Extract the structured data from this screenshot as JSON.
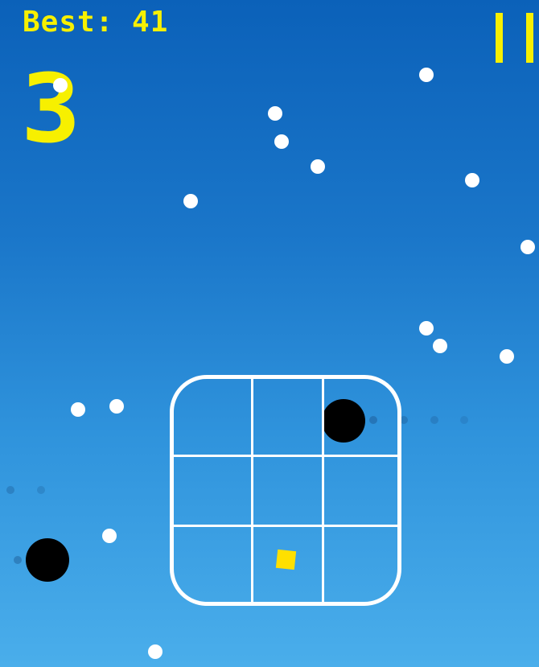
{
  "hud": {
    "best_label": "Best: 41",
    "score": "3",
    "pause_icon": "pause-icon"
  },
  "colors": {
    "hud_yellow": "#f7f000",
    "player_yellow": "#ffe000",
    "grid_white": "#ffffff",
    "enemy_black": "#000000",
    "bg_top": "#0b61b9",
    "bg_bottom": "#4aaeeb"
  },
  "board": {
    "rows": 3,
    "cols": 3
  }
}
